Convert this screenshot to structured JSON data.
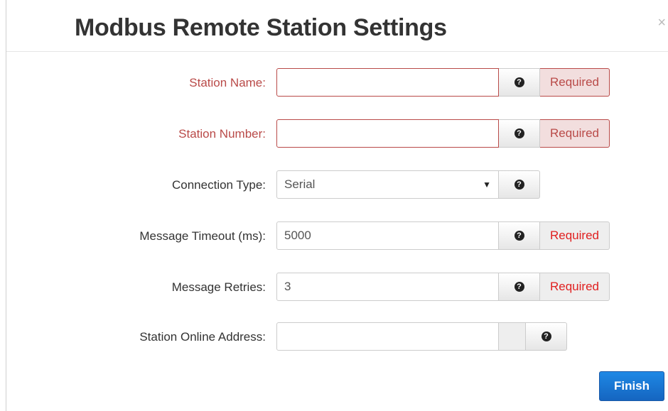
{
  "dialog": {
    "title": "Modbus Remote Station Settings",
    "close_glyph": "×"
  },
  "fields": {
    "station_name": {
      "label": "Station Name:",
      "value": "",
      "addon": "Required"
    },
    "station_number": {
      "label": "Station Number:",
      "value": "",
      "addon": "Required"
    },
    "connection_type": {
      "label": "Connection Type:",
      "selected": "Serial"
    },
    "message_timeout": {
      "label": "Message Timeout (ms):",
      "value": "5000",
      "addon": "Required"
    },
    "message_retries": {
      "label": "Message Retries:",
      "value": "3",
      "addon": "Required"
    },
    "station_online_address": {
      "label": "Station Online Address:",
      "value": ""
    }
  },
  "help_glyph": "?",
  "caret_glyph": "▼",
  "footer": {
    "finish_label": "Finish"
  },
  "colors": {
    "error": "#b94a48",
    "required_text": "#e02020",
    "primary": "#1565c0"
  }
}
